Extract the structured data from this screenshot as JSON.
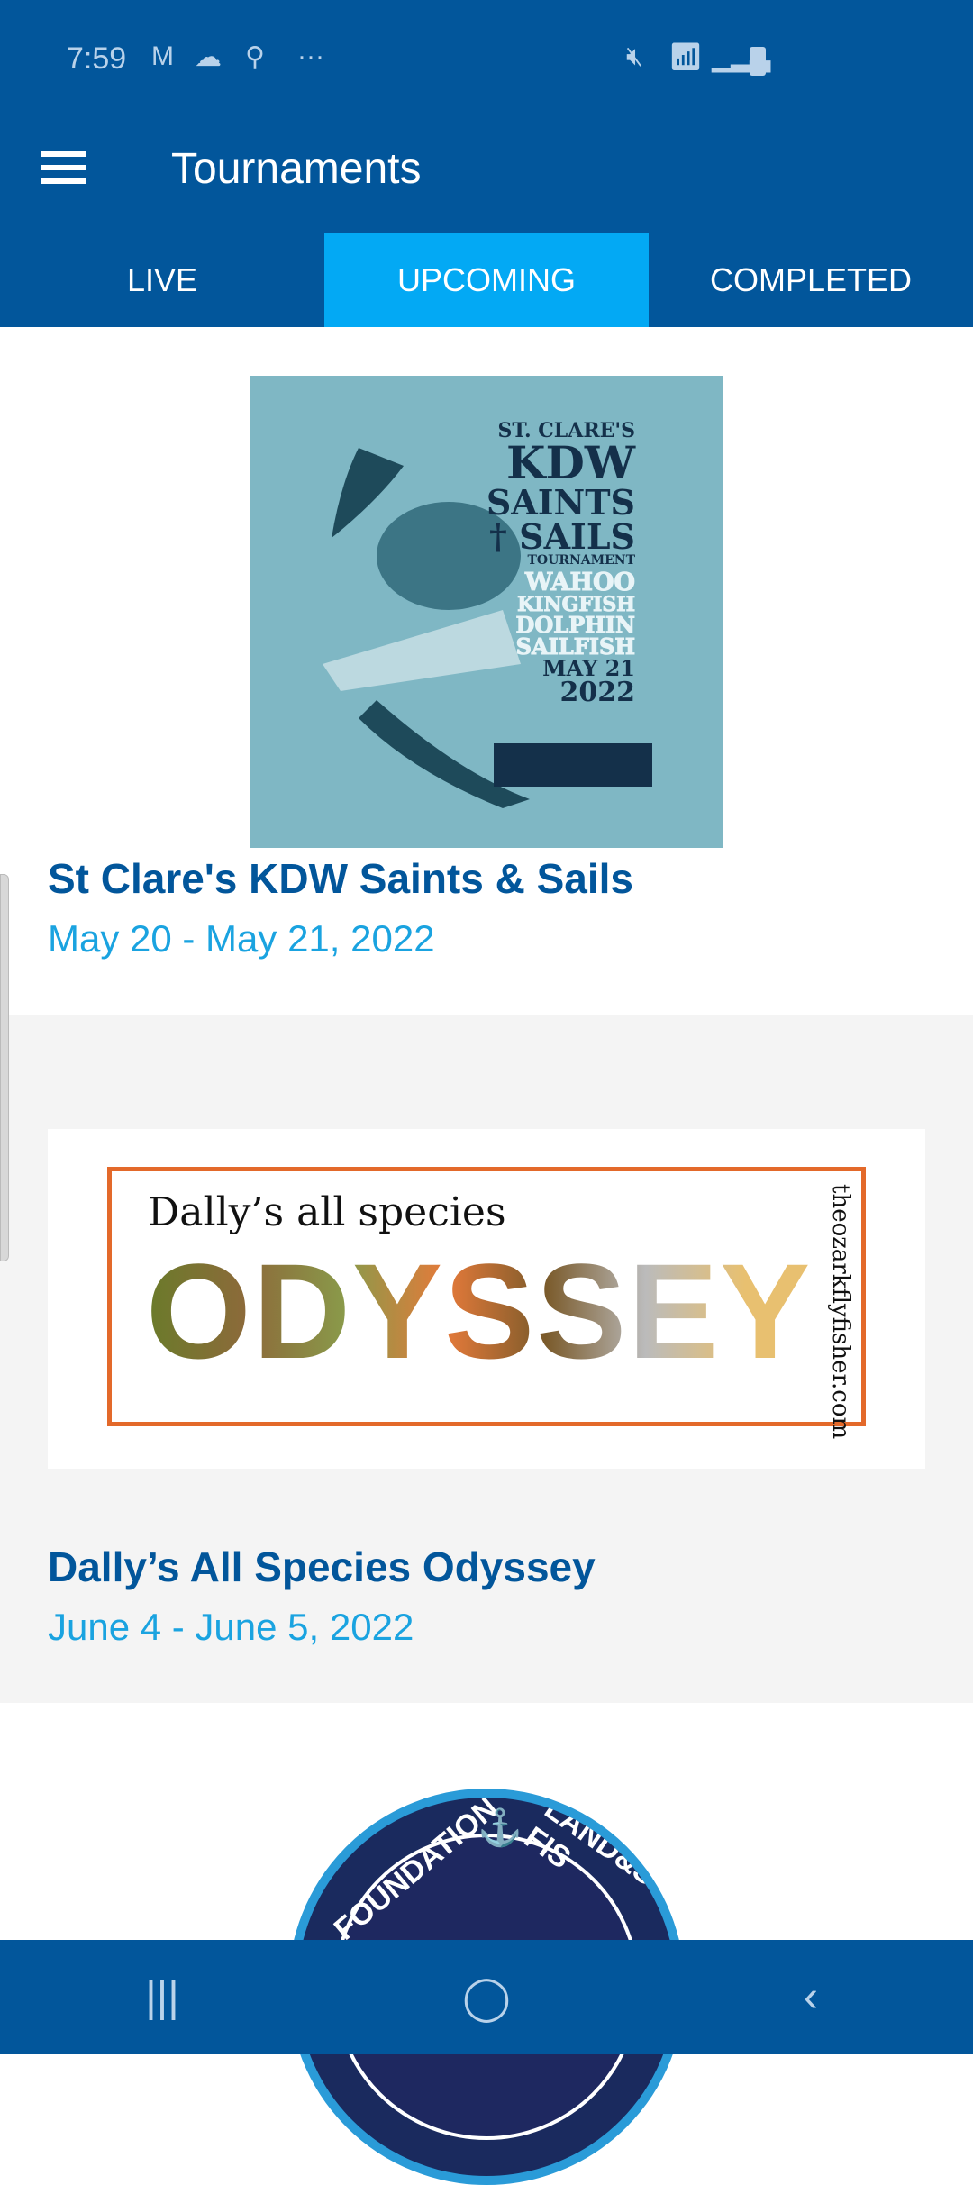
{
  "status_bar": {
    "time": "7:59",
    "left_icons": [
      "gmail-icon",
      "cloud-icon",
      "location-icon",
      "more-icon"
    ],
    "right_icons": [
      "mute-icon",
      "wifi-icon",
      "signal-icon",
      "battery-icon"
    ]
  },
  "toolbar": {
    "title": "Tournaments",
    "menu_icon": "hamburger-icon"
  },
  "tabs": [
    {
      "label": "LIVE",
      "active": false
    },
    {
      "label": "UPCOMING",
      "active": true
    },
    {
      "label": "COMPLETED",
      "active": false
    }
  ],
  "colors": {
    "primary": "#02569b",
    "accent": "#03a9f4",
    "date": "#1aa3e0"
  },
  "tournaments": [
    {
      "title": "St Clare's KDW Saints & Sails",
      "dates": "May 20 - May 21, 2022",
      "poster": {
        "line1": "ST. CLARE'S",
        "line2": "KDW",
        "line3": "SAINTS",
        "line4": "† SAILS",
        "line5": "TOURNAMENT",
        "species": [
          "WAHOO",
          "KINGFISH",
          "DOLPHIN",
          "SAILFISH"
        ],
        "date1": "MAY 21",
        "date2": "2022"
      }
    },
    {
      "title": "Dally’s All Species Odyssey",
      "dates": "June 4 - June 5, 2022",
      "poster": {
        "subtitle": "Dally’s all species",
        "big": "ODYSSEY",
        "side": "theozarkflyfisher.com"
      }
    },
    {
      "poster": {
        "left": "FOUNDATION",
        "right": "LAND&SEA FIS"
      }
    }
  ],
  "navbar": {
    "recent": "|||",
    "home": "◯",
    "back": "‹"
  }
}
